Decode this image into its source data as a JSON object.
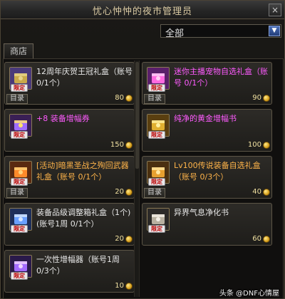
{
  "window": {
    "title": "忧心忡忡的夜市管理员",
    "close_label": "×"
  },
  "filter": {
    "value": "全部",
    "arrow": "▼"
  },
  "tab": {
    "label": "商店"
  },
  "common": {
    "limit_tag": "限定",
    "catalog_label": "目录"
  },
  "items": [
    {
      "name": "12周年庆贺王冠礼盒（账号 0/1个）",
      "price": "80",
      "color": "white",
      "icon": "crown-box-icon",
      "has_catalog": true
    },
    {
      "name": "迷你主播宠物自选礼盒（账号 0/1个）",
      "price": "90",
      "color": "magenta",
      "icon": "pet-box-icon",
      "has_catalog": true
    },
    {
      "name": "+8 装备增幅券",
      "price": "150",
      "color": "magenta",
      "icon": "amplify-ticket-icon",
      "has_catalog": false
    },
    {
      "name": "纯净的黄金增幅书",
      "price": "100",
      "color": "magenta",
      "icon": "golden-book-icon",
      "has_catalog": false
    },
    {
      "name": "[活动]暗黑圣战之殉回武器礼盒（账号 0/1个）",
      "price": "20",
      "color": "orange",
      "icon": "weapon-box-icon",
      "has_catalog": true
    },
    {
      "name": "Lv100传说装备自选礼盒（账号 0/3个）",
      "price": "40",
      "color": "orange",
      "icon": "legend-box-icon",
      "has_catalog": true
    },
    {
      "name": "装备品级调整箱礼盒（1个)(账号1周 0/1个）",
      "price": "20",
      "color": "white",
      "icon": "grade-box-icon",
      "has_catalog": false
    },
    {
      "name": "异界气息净化书",
      "price": "60",
      "color": "white",
      "icon": "purify-book-icon",
      "has_catalog": false
    },
    {
      "name": "一次性增幅器（账号1周 0/3个）",
      "price": "10",
      "color": "white",
      "icon": "amplifier-icon",
      "has_catalog": false
    }
  ],
  "watermark": "头条 @DNF心情屋"
}
